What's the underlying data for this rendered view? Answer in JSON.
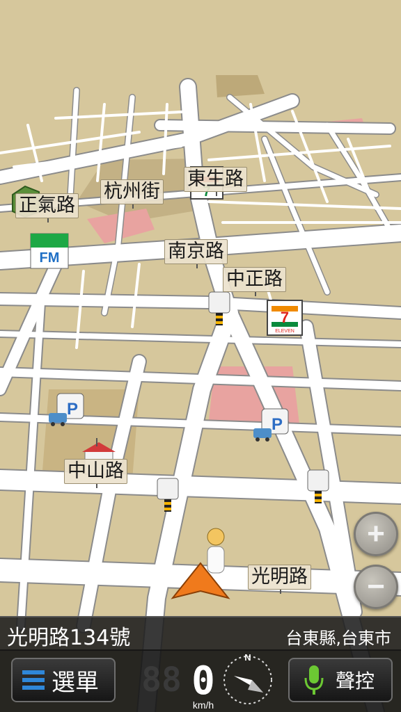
{
  "map": {
    "street_labels": [
      {
        "id": "zhengqi",
        "text": "正氣路"
      },
      {
        "id": "hangzhou",
        "text": "杭州街"
      },
      {
        "id": "dongsheng",
        "text": "東生路"
      },
      {
        "id": "nanjing",
        "text": "南京路"
      },
      {
        "id": "zhongzheng",
        "text": "中正路"
      },
      {
        "id": "zhongshan",
        "text": "中山路"
      },
      {
        "id": "guangming",
        "text": "光明路"
      }
    ],
    "poi_icons": [
      "convenience-store-icon",
      "radio-station-icon",
      "parking-icon",
      "police-station-icon",
      "camera-icon",
      "landmark-icon"
    ],
    "fm_text": "FM",
    "seven_text": "7",
    "eleven_text": "ELEVEN",
    "parking_text": "P"
  },
  "zoom": {
    "in_label": "+",
    "out_label": "−"
  },
  "status": {
    "address": "光明路134號",
    "region": "台東縣,台東市"
  },
  "controls": {
    "menu_label": "選單",
    "voice_label": "聲控",
    "speed_value": "0",
    "speed_ghost": "88",
    "speed_unit": "km/h",
    "compass_letter": "N"
  },
  "colors": {
    "map_background": "#d6c79c",
    "road": "#ffffff",
    "road_border": "#8f8f8f",
    "block_highlight": "#e8a3a0",
    "nav_arrow": "#f07a1c",
    "voice_mic": "#6cc833",
    "menu_icon": "#2f87d9"
  }
}
